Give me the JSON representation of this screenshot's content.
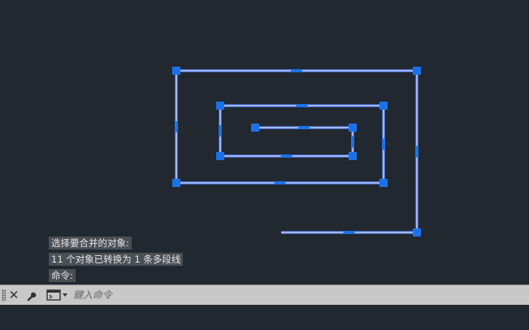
{
  "command_history": [
    "选择要合并的对象:",
    "11 个对象已转换为 1 条多段线",
    "命令:"
  ],
  "command_input": {
    "value": "",
    "placeholder": "鍵入命令"
  },
  "toolbar": {
    "close_icon": "close-icon",
    "customize_icon": "wrench-icon",
    "recent_commands_icon": "command-prompt-icon"
  },
  "colors": {
    "canvas_background": "#212830",
    "polyline": "#5d86ff",
    "polyline_highlight": "#dfe6ff",
    "grip": "#1b72e8",
    "command_bar": "#c8c8c8"
  }
}
